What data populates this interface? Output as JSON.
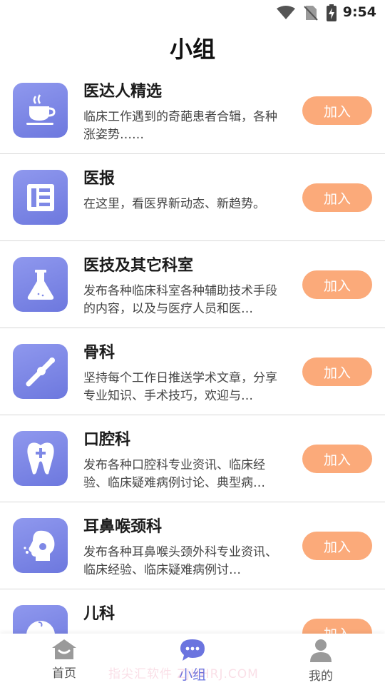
{
  "status": {
    "time": "9:54"
  },
  "header": {
    "title": "小组"
  },
  "groups": [
    {
      "name": "医达人精选",
      "desc": "临床工作遇到的奇葩患者合辑，各种涨姿势……",
      "join_label": "加入",
      "icon": "coffee-cup-icon"
    },
    {
      "name": "医报",
      "desc": "在这里，看医界新动态、新趋势。",
      "join_label": "加入",
      "icon": "newspaper-icon"
    },
    {
      "name": "医技及其它科室",
      "desc": "发布各种临床科室各种辅助技术手段的内容，以及与医疗人员和医…",
      "join_label": "加入",
      "icon": "flask-icon"
    },
    {
      "name": "骨科",
      "desc": "坚持每个工作日推送学术文章，分享专业知识、手术技巧，欢迎与…",
      "join_label": "加入",
      "icon": "bone-joint-icon"
    },
    {
      "name": "口腔科",
      "desc": "发布各种口腔科专业资讯、临床经验、临床疑难病例讨论、典型病…",
      "join_label": "加入",
      "icon": "tooth-icon"
    },
    {
      "name": "耳鼻喉颈科",
      "desc": "发布各种耳鼻喉头颈外科专业资讯、临床经验、临床疑难病例讨…",
      "join_label": "加入",
      "icon": "head-profile-icon"
    },
    {
      "name": "儿科",
      "desc": "",
      "join_label": "加入",
      "icon": "baby-face-icon"
    }
  ],
  "tabs": [
    {
      "label": "首页",
      "icon": "home-icon"
    },
    {
      "label": "小组",
      "icon": "chat-bubble-icon",
      "active": true
    },
    {
      "label": "我的",
      "icon": "user-icon"
    }
  ],
  "watermark": "指尖汇软件 ZJHHRJ.COM",
  "colors": {
    "accent": "#6b74df",
    "join_button": "#fbaa7a",
    "icon_bg": "#7e88e6"
  }
}
